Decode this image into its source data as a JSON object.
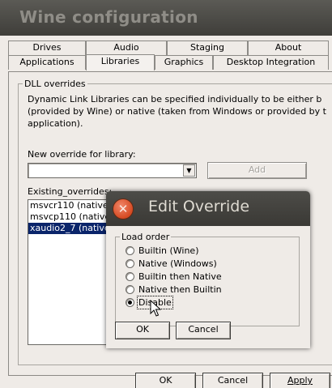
{
  "window": {
    "title": "Wine configuration"
  },
  "tabs_row1": [
    "Drives",
    "Audio",
    "Staging",
    "About"
  ],
  "tabs_row2": [
    "Applications",
    "Libraries",
    "Graphics",
    "Desktop Integration"
  ],
  "active_tab": "Libraries",
  "dll_group": {
    "title": "DLL overrides",
    "description_lines": [
      "Dynamic Link Libraries can be specified individually to be either b",
      "(provided by Wine) or native (taken from Windows or provided by t",
      "application)."
    ],
    "new_override_label": "New override for library:",
    "new_override_value": "",
    "add_button": "Add",
    "existing_label": "Existing_overrides:",
    "existing_items": [
      "msvcr110 (native,",
      "msvcp110 (native,",
      "xaudio2_7 (native"
    ],
    "selected_index": 2
  },
  "dialog": {
    "title": "Edit Override",
    "close_icon": "close-icon",
    "group_title": "Load order",
    "options": [
      "Builtin (Wine)",
      "Native (Windows)",
      "Builtin then Native",
      "Native then Builtin",
      "Disable"
    ],
    "selected_option": 4,
    "ok_button": "OK",
    "cancel_button": "Cancel"
  },
  "footer": {
    "ok": "OK",
    "cancel": "Cancel",
    "apply": "Apply"
  },
  "colors": {
    "selection": "#0a246a",
    "close_button": "#e0623c",
    "titlebar": "#45443f"
  }
}
